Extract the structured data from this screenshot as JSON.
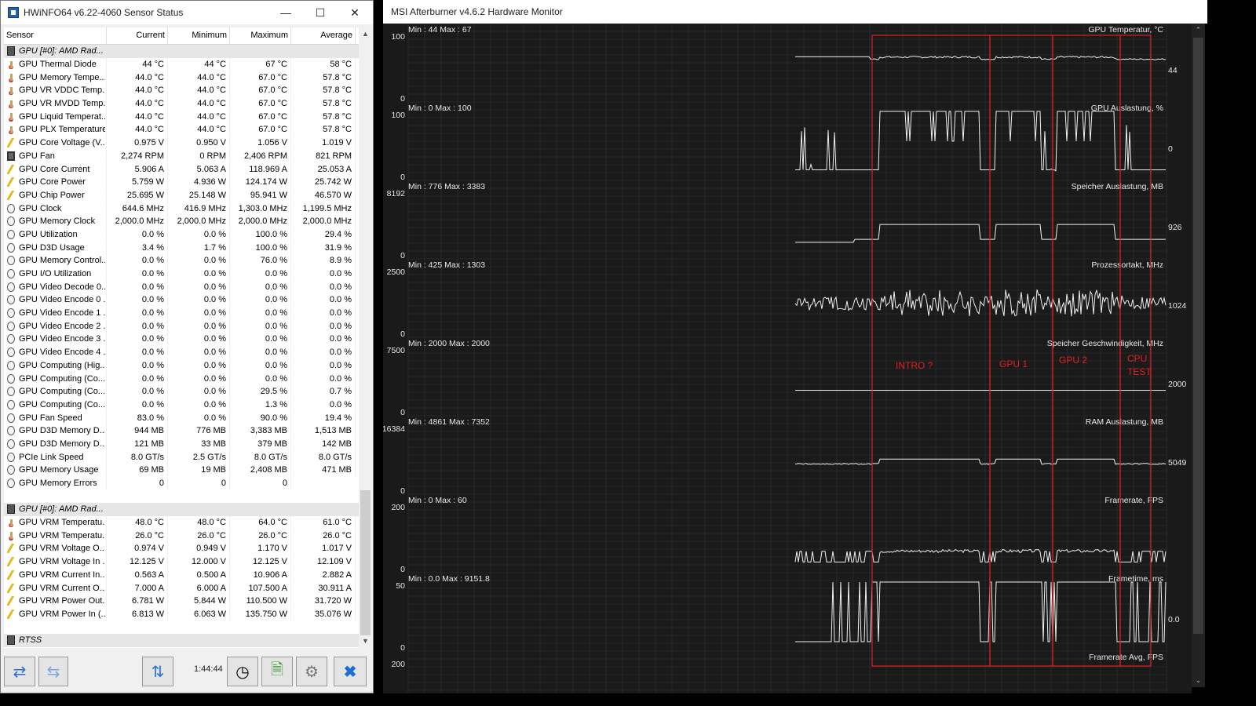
{
  "hwinfo": {
    "title": "HWiNFO64 v6.22-4060 Sensor Status",
    "columns": [
      "Sensor",
      "Current",
      "Minimum",
      "Maximum",
      "Average"
    ],
    "rows": [
      {
        "type": "group",
        "name": "GPU [#0]: AMD Rad..."
      },
      {
        "icon": "temp",
        "name": "GPU Thermal Diode",
        "cur": "44 °C",
        "min": "44 °C",
        "max": "67 °C",
        "avg": "58 °C"
      },
      {
        "icon": "temp",
        "name": "GPU Memory Tempe...",
        "cur": "44.0 °C",
        "min": "44.0 °C",
        "max": "67.0 °C",
        "avg": "57.8 °C"
      },
      {
        "icon": "temp",
        "name": "GPU VR VDDC Temp...",
        "cur": "44.0 °C",
        "min": "44.0 °C",
        "max": "67.0 °C",
        "avg": "57.8 °C"
      },
      {
        "icon": "temp",
        "name": "GPU VR MVDD Temp...",
        "cur": "44.0 °C",
        "min": "44.0 °C",
        "max": "67.0 °C",
        "avg": "57.8 °C"
      },
      {
        "icon": "temp",
        "name": "GPU Liquid Temperat...",
        "cur": "44.0 °C",
        "min": "44.0 °C",
        "max": "67.0 °C",
        "avg": "57.8 °C"
      },
      {
        "icon": "temp",
        "name": "GPU PLX Temperature",
        "cur": "44.0 °C",
        "min": "44.0 °C",
        "max": "67.0 °C",
        "avg": "57.8 °C"
      },
      {
        "icon": "volt",
        "name": "GPU Core Voltage (V...",
        "cur": "0.975 V",
        "min": "0.950 V",
        "max": "1.056 V",
        "avg": "1.019 V"
      },
      {
        "icon": "fan",
        "name": "GPU Fan",
        "cur": "2,274 RPM",
        "min": "0 RPM",
        "max": "2,406 RPM",
        "avg": "821 RPM"
      },
      {
        "icon": "volt",
        "name": "GPU Core Current",
        "cur": "5.906 A",
        "min": "5.063 A",
        "max": "118.969 A",
        "avg": "25.053 A"
      },
      {
        "icon": "volt",
        "name": "GPU Core Power",
        "cur": "5.759 W",
        "min": "4.936 W",
        "max": "124.174 W",
        "avg": "25.742 W"
      },
      {
        "icon": "volt",
        "name": "GPU Chip Power",
        "cur": "25.695 W",
        "min": "25.148 W",
        "max": "95.941 W",
        "avg": "46.570 W"
      },
      {
        "icon": "clock",
        "name": "GPU Clock",
        "cur": "644.6 MHz",
        "min": "416.9 MHz",
        "max": "1,303.0 MHz",
        "avg": "1,199.5 MHz"
      },
      {
        "icon": "clock",
        "name": "GPU Memory Clock",
        "cur": "2,000.0 MHz",
        "min": "2,000.0 MHz",
        "max": "2,000.0 MHz",
        "avg": "2,000.0 MHz"
      },
      {
        "icon": "clock",
        "name": "GPU Utilization",
        "cur": "0.0 %",
        "min": "0.0 %",
        "max": "100.0 %",
        "avg": "29.4 %"
      },
      {
        "icon": "clock",
        "name": "GPU D3D Usage",
        "cur": "3.4 %",
        "min": "1.7 %",
        "max": "100.0 %",
        "avg": "31.9 %"
      },
      {
        "icon": "clock",
        "name": "GPU Memory Control...",
        "cur": "0.0 %",
        "min": "0.0 %",
        "max": "76.0 %",
        "avg": "8.9 %"
      },
      {
        "icon": "clock",
        "name": "GPU I/O Utilization",
        "cur": "0.0 %",
        "min": "0.0 %",
        "max": "0.0 %",
        "avg": "0.0 %"
      },
      {
        "icon": "clock",
        "name": "GPU Video Decode 0...",
        "cur": "0.0 %",
        "min": "0.0 %",
        "max": "0.0 %",
        "avg": "0.0 %"
      },
      {
        "icon": "clock",
        "name": "GPU Video Encode 0 ...",
        "cur": "0.0 %",
        "min": "0.0 %",
        "max": "0.0 %",
        "avg": "0.0 %"
      },
      {
        "icon": "clock",
        "name": "GPU Video Encode 1 ...",
        "cur": "0.0 %",
        "min": "0.0 %",
        "max": "0.0 %",
        "avg": "0.0 %"
      },
      {
        "icon": "clock",
        "name": "GPU Video Encode 2 ...",
        "cur": "0.0 %",
        "min": "0.0 %",
        "max": "0.0 %",
        "avg": "0.0 %"
      },
      {
        "icon": "clock",
        "name": "GPU Video Encode 3 ...",
        "cur": "0.0 %",
        "min": "0.0 %",
        "max": "0.0 %",
        "avg": "0.0 %"
      },
      {
        "icon": "clock",
        "name": "GPU Video Encode 4 ...",
        "cur": "0.0 %",
        "min": "0.0 %",
        "max": "0.0 %",
        "avg": "0.0 %"
      },
      {
        "icon": "clock",
        "name": "GPU Computing (Hig...",
        "cur": "0.0 %",
        "min": "0.0 %",
        "max": "0.0 %",
        "avg": "0.0 %"
      },
      {
        "icon": "clock",
        "name": "GPU Computing (Co...",
        "cur": "0.0 %",
        "min": "0.0 %",
        "max": "0.0 %",
        "avg": "0.0 %"
      },
      {
        "icon": "clock",
        "name": "GPU Computing (Co...",
        "cur": "0.0 %",
        "min": "0.0 %",
        "max": "29.5 %",
        "avg": "0.7 %"
      },
      {
        "icon": "clock",
        "name": "GPU Computing (Co...",
        "cur": "0.0 %",
        "min": "0.0 %",
        "max": "1.3 %",
        "avg": "0.0 %"
      },
      {
        "icon": "clock",
        "name": "GPU Fan Speed",
        "cur": "83.0 %",
        "min": "0.0 %",
        "max": "90.0 %",
        "avg": "19.4 %"
      },
      {
        "icon": "clock",
        "name": "GPU D3D Memory D...",
        "cur": "944 MB",
        "min": "776 MB",
        "max": "3,383 MB",
        "avg": "1,513 MB"
      },
      {
        "icon": "clock",
        "name": "GPU D3D Memory D...",
        "cur": "121 MB",
        "min": "33 MB",
        "max": "379 MB",
        "avg": "142 MB"
      },
      {
        "icon": "clock",
        "name": "PCIe Link Speed",
        "cur": "8.0 GT/s",
        "min": "2.5 GT/s",
        "max": "8.0 GT/s",
        "avg": "8.0 GT/s"
      },
      {
        "icon": "clock",
        "name": "GPU Memory Usage",
        "cur": "69 MB",
        "min": "19 MB",
        "max": "2,408 MB",
        "avg": "471 MB"
      },
      {
        "icon": "clock",
        "name": "GPU Memory Errors",
        "cur": "0",
        "min": "0",
        "max": "0",
        "avg": ""
      },
      {
        "type": "blank"
      },
      {
        "type": "group",
        "name": "GPU [#0]: AMD Rad..."
      },
      {
        "icon": "temp",
        "name": "GPU VRM Temperatu...",
        "cur": "48.0 °C",
        "min": "48.0 °C",
        "max": "64.0 °C",
        "avg": "61.0 °C"
      },
      {
        "icon": "temp",
        "name": "GPU VRM Temperatu...",
        "cur": "26.0 °C",
        "min": "26.0 °C",
        "max": "26.0 °C",
        "avg": "26.0 °C"
      },
      {
        "icon": "volt",
        "name": "GPU VRM Voltage O...",
        "cur": "0.974 V",
        "min": "0.949 V",
        "max": "1.170 V",
        "avg": "1.017 V"
      },
      {
        "icon": "volt",
        "name": "GPU VRM Voltage In ...",
        "cur": "12.125 V",
        "min": "12.000 V",
        "max": "12.125 V",
        "avg": "12.109 V"
      },
      {
        "icon": "volt",
        "name": "GPU VRM Current In...",
        "cur": "0.563 A",
        "min": "0.500 A",
        "max": "10.906 A",
        "avg": "2.882 A"
      },
      {
        "icon": "volt",
        "name": "GPU VRM Current O...",
        "cur": "7.000 A",
        "min": "6.000 A",
        "max": "107.500 A",
        "avg": "30.911 A"
      },
      {
        "icon": "volt",
        "name": "GPU VRM Power Out...",
        "cur": "6.781 W",
        "min": "5.844 W",
        "max": "110.500 W",
        "avg": "31.720 W"
      },
      {
        "icon": "volt",
        "name": "GPU VRM Power In (...",
        "cur": "6.813 W",
        "min": "6.063 W",
        "max": "135.750 W",
        "avg": "35.076 W"
      },
      {
        "type": "blank"
      },
      {
        "type": "group",
        "name": "RTSS"
      }
    ],
    "elapsed": "1:44:44"
  },
  "afterburner": {
    "title": "MSI Afterburner v4.6.2 Hardware Monitor",
    "panels": [
      {
        "name": "GPU Temperatur, °C",
        "stats": "Min : 44   Max : 67",
        "top": "100",
        "bottom": "0",
        "current": "44",
        "shape": "temp"
      },
      {
        "name": "GPU Auslastung, %",
        "stats": "Min : 0   Max : 100",
        "top": "100",
        "bottom": "0",
        "current": "0",
        "shape": "util"
      },
      {
        "name": "Speicher Auslastung, MB",
        "stats": "Min : 776   Max : 3383",
        "top": "8192",
        "bottom": "0",
        "current": "926",
        "shape": "mem"
      },
      {
        "name": "Prozessortakt, MHz",
        "stats": "Min : 425   Max : 1303",
        "top": "2500",
        "bottom": "0",
        "current": "1024",
        "shape": "clock"
      },
      {
        "name": "Speicher Geschwindigkeit, MHz",
        "stats": "Min : 2000   Max : 2000",
        "top": "7500",
        "bottom": "0",
        "current": "2000",
        "shape": "flat"
      },
      {
        "name": "RAM Auslastung, MB",
        "stats": "Min : 4861   Max : 7352",
        "top": "16384",
        "bottom": "0",
        "current": "5049",
        "shape": "ram"
      },
      {
        "name": "Framerate, FPS",
        "stats": "Min : 0   Max : 60",
        "top": "200",
        "bottom": "0",
        "current": "",
        "shape": "fps"
      },
      {
        "name": "Frametime, ms",
        "stats": "Min : 0.0   Max : 9151.8",
        "top": "50",
        "bottom": "0",
        "current": "0.0",
        "shape": "frametime"
      },
      {
        "name": "Framerate Avg, FPS",
        "stats": "",
        "top": "200",
        "bottom": "",
        "current": "",
        "shape": "none"
      }
    ],
    "annotations": {
      "intro": "INTRO ?",
      "gpu1": "GPU 1",
      "gpu2": "GPU 2",
      "cpu_line1": "CPU",
      "cpu_line2": "TEST"
    },
    "annotation_color": "#e02020"
  }
}
